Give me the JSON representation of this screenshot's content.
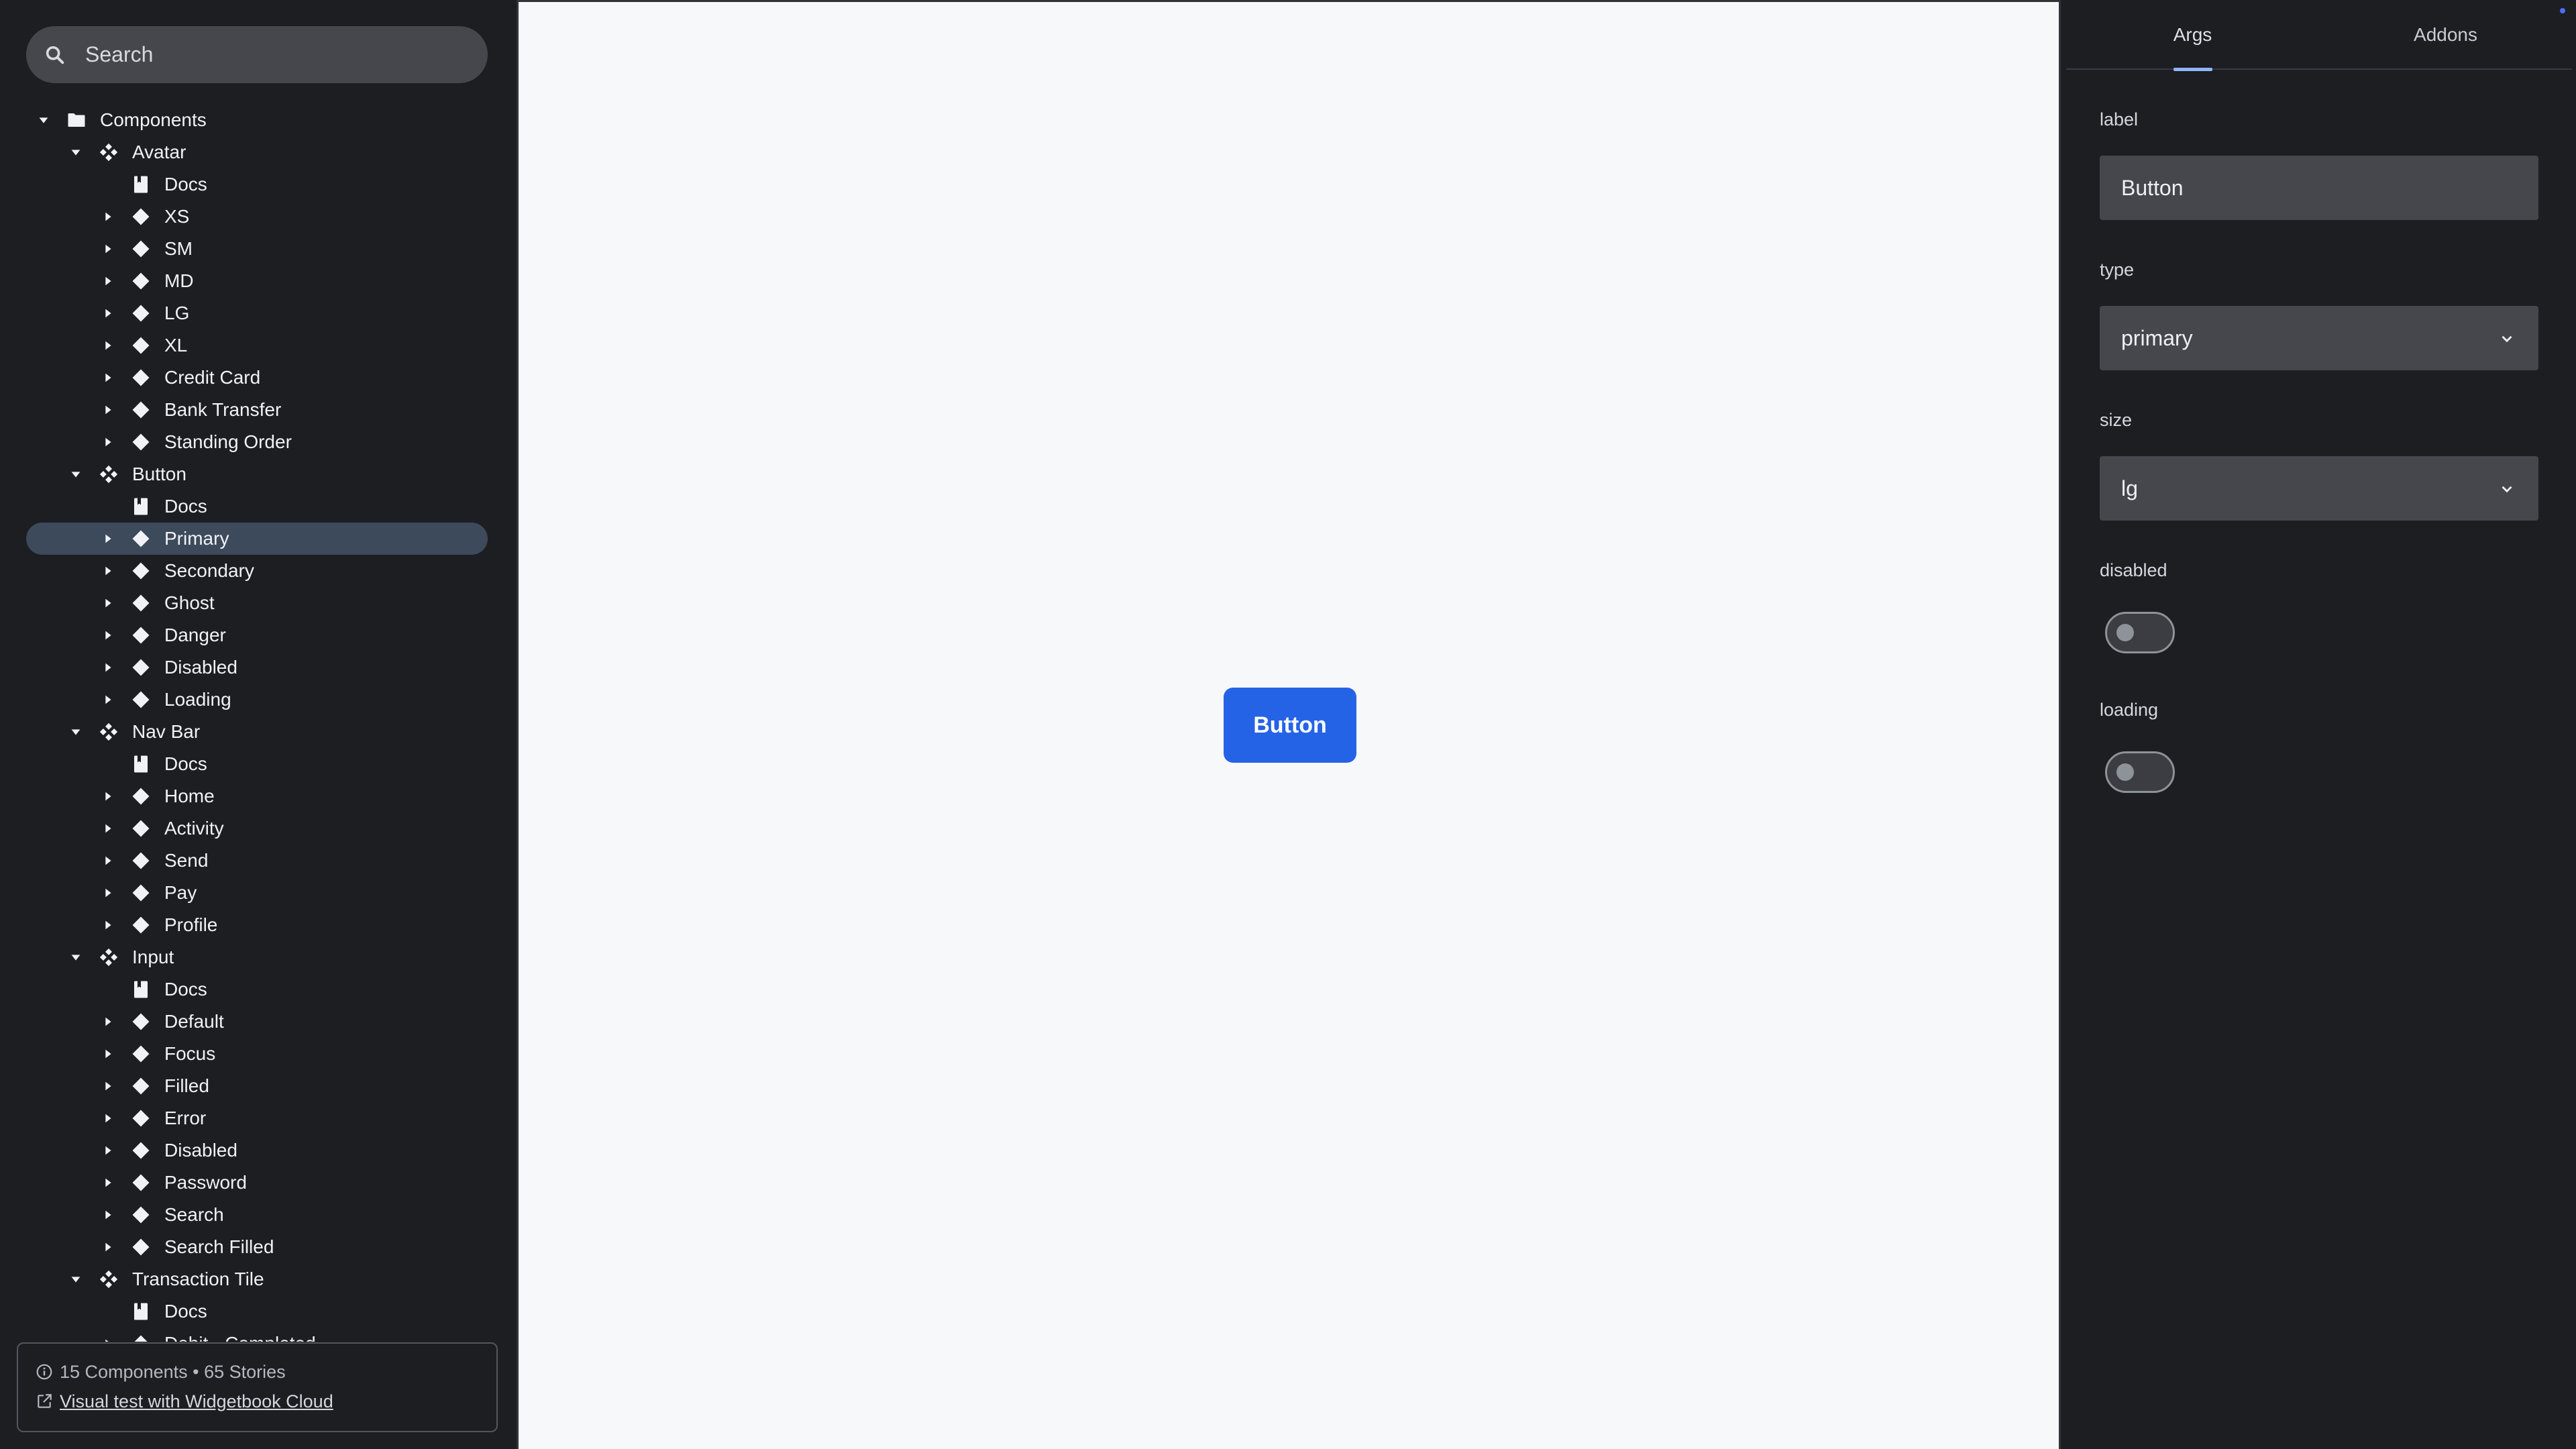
{
  "search": {
    "placeholder": "Search"
  },
  "tree": [
    {
      "label": "Components",
      "depth": 0,
      "kind": "folder",
      "caret": "down"
    },
    {
      "label": "Avatar",
      "depth": 1,
      "kind": "component",
      "caret": "down"
    },
    {
      "label": "Docs",
      "depth": 2,
      "kind": "docs",
      "caret": "none"
    },
    {
      "label": "XS",
      "depth": 2,
      "kind": "story",
      "caret": "right"
    },
    {
      "label": "SM",
      "depth": 2,
      "kind": "story",
      "caret": "right"
    },
    {
      "label": "MD",
      "depth": 2,
      "kind": "story",
      "caret": "right"
    },
    {
      "label": "LG",
      "depth": 2,
      "kind": "story",
      "caret": "right"
    },
    {
      "label": "XL",
      "depth": 2,
      "kind": "story",
      "caret": "right"
    },
    {
      "label": "Credit Card",
      "depth": 2,
      "kind": "story",
      "caret": "right"
    },
    {
      "label": "Bank Transfer",
      "depth": 2,
      "kind": "story",
      "caret": "right"
    },
    {
      "label": "Standing Order",
      "depth": 2,
      "kind": "story",
      "caret": "right"
    },
    {
      "label": "Button",
      "depth": 1,
      "kind": "component",
      "caret": "down"
    },
    {
      "label": "Docs",
      "depth": 2,
      "kind": "docs",
      "caret": "none"
    },
    {
      "label": "Primary",
      "depth": 2,
      "kind": "story",
      "caret": "right",
      "selected": true
    },
    {
      "label": "Secondary",
      "depth": 2,
      "kind": "story",
      "caret": "right"
    },
    {
      "label": "Ghost",
      "depth": 2,
      "kind": "story",
      "caret": "right"
    },
    {
      "label": "Danger",
      "depth": 2,
      "kind": "story",
      "caret": "right"
    },
    {
      "label": "Disabled",
      "depth": 2,
      "kind": "story",
      "caret": "right"
    },
    {
      "label": "Loading",
      "depth": 2,
      "kind": "story",
      "caret": "right"
    },
    {
      "label": "Nav Bar",
      "depth": 1,
      "kind": "component",
      "caret": "down"
    },
    {
      "label": "Docs",
      "depth": 2,
      "kind": "docs",
      "caret": "none"
    },
    {
      "label": "Home",
      "depth": 2,
      "kind": "story",
      "caret": "right"
    },
    {
      "label": "Activity",
      "depth": 2,
      "kind": "story",
      "caret": "right"
    },
    {
      "label": "Send",
      "depth": 2,
      "kind": "story",
      "caret": "right"
    },
    {
      "label": "Pay",
      "depth": 2,
      "kind": "story",
      "caret": "right"
    },
    {
      "label": "Profile",
      "depth": 2,
      "kind": "story",
      "caret": "right"
    },
    {
      "label": "Input",
      "depth": 1,
      "kind": "component",
      "caret": "down"
    },
    {
      "label": "Docs",
      "depth": 2,
      "kind": "docs",
      "caret": "none"
    },
    {
      "label": "Default",
      "depth": 2,
      "kind": "story",
      "caret": "right"
    },
    {
      "label": "Focus",
      "depth": 2,
      "kind": "story",
      "caret": "right"
    },
    {
      "label": "Filled",
      "depth": 2,
      "kind": "story",
      "caret": "right"
    },
    {
      "label": "Error",
      "depth": 2,
      "kind": "story",
      "caret": "right"
    },
    {
      "label": "Disabled",
      "depth": 2,
      "kind": "story",
      "caret": "right"
    },
    {
      "label": "Password",
      "depth": 2,
      "kind": "story",
      "caret": "right"
    },
    {
      "label": "Search",
      "depth": 2,
      "kind": "story",
      "caret": "right"
    },
    {
      "label": "Search Filled",
      "depth": 2,
      "kind": "story",
      "caret": "right"
    },
    {
      "label": "Transaction Tile",
      "depth": 1,
      "kind": "component",
      "caret": "down"
    },
    {
      "label": "Docs",
      "depth": 2,
      "kind": "docs",
      "caret": "none"
    },
    {
      "label": "Debit - Completed",
      "depth": 2,
      "kind": "story",
      "caret": "right"
    }
  ],
  "footer": {
    "stats": "15 Components • 65 Stories",
    "cloud_link": "Visual test with Widgetbook Cloud",
    "info_icon": "info-icon",
    "link_icon": "external-link-icon"
  },
  "preview": {
    "button_label": "Button",
    "button_color": "#2563e6"
  },
  "panel": {
    "tabs": [
      {
        "label": "Args"
      },
      {
        "label": "Addons"
      }
    ],
    "active_tab": "Args",
    "args": {
      "label": {
        "name": "label",
        "value": "Button"
      },
      "type": {
        "name": "type",
        "value": "primary"
      },
      "size": {
        "name": "size",
        "value": "lg"
      },
      "disabled": {
        "name": "disabled",
        "value": false
      },
      "loading": {
        "name": "loading",
        "value": false
      }
    }
  },
  "colors": {
    "sidebar_bg": "#1d1e22",
    "canvas_bg": "#f7f8fa",
    "selected_row": "#3d4a5c",
    "tab_underline": "#8fb6ff",
    "input_bg": "#45474d"
  }
}
